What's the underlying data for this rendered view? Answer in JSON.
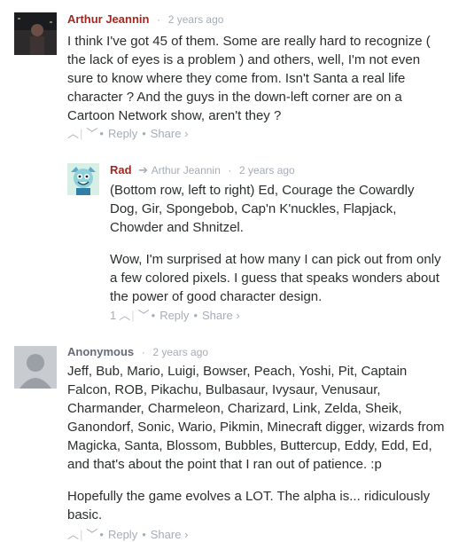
{
  "comments": [
    {
      "author": "Arthur Jeannin",
      "time": "2 years ago",
      "text": "I think I've got 45 of them. Some are really hard to recognize ( the lack of eyes is a problem ) and others, well, I'm not even sure to know where they come from. Isn't Santa a real life character ? And the guys in the down-left corner are on a Cartoon Network show, aren't they ?",
      "reply_label": "Reply",
      "share_label": "Share ›"
    },
    {
      "author": "Rad",
      "in_reply_to": "Arthur Jeannin",
      "time": "2 years ago",
      "paragraphs": [
        "(Bottom row, left to right) Ed, Courage the Cowardly Dog, Gir, Spongebob, Cap'n K'nuckles, Flapjack, Chowder and Shnitzel.",
        "Wow, I'm surprised at how many I can pick out from only a few colored pixels. I guess that speaks wonders about the power of good character design."
      ],
      "upvotes": "1",
      "reply_label": "Reply",
      "share_label": "Share ›"
    },
    {
      "author": "Anonymous",
      "time": "2 years ago",
      "paragraphs": [
        "Jeff, Bub, Mario, Luigi, Bowser, Peach, Yoshi, Pit, Captain Falcon, ROB, Pikachu, Bulbasaur, Ivysaur, Venusaur, Charmander, Charmeleon, Charizard, Link, Zelda, Sheik, Ganondorf, Sonic, Wario, Pikmin, Minecraft digger, wizards from Magicka, Santa, Blossom, Bubbles, Buttercup, Eddy, Edd, Ed, and that's about the point that I ran out of patience. :p",
        "Hopefully the game evolves a LOT. The alpha is... ridiculously basic."
      ],
      "reply_label": "Reply",
      "share_label": "Share ›"
    }
  ],
  "colors": {
    "author": "#a3271f",
    "meta": "#a5adb7",
    "text": "#2a2e2e",
    "anon_author": "#656c7a"
  }
}
